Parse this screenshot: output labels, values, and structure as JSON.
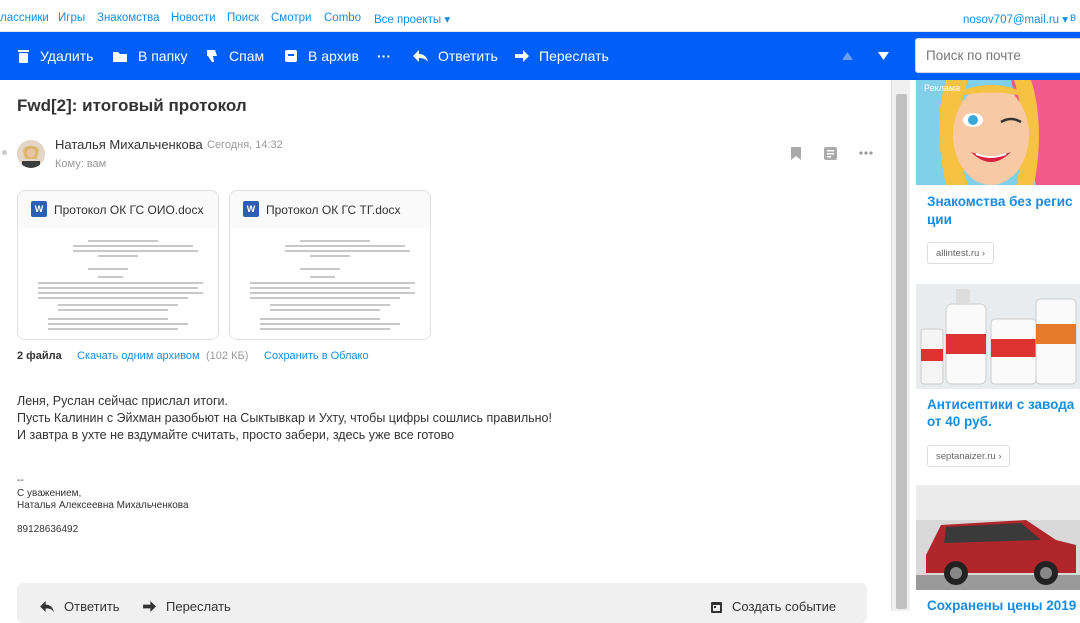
{
  "topnav": {
    "items": [
      "лассники",
      "Игры",
      "Знакомства",
      "Новости",
      "Поиск",
      "Смотри",
      "Combo",
      "Все проекты ▾"
    ],
    "user": "nosov707@mail.ru ▾",
    "extra": "в"
  },
  "toolbar": {
    "delete": "Удалить",
    "to_folder": "В папку",
    "spam": "Спам",
    "archive": "В архив",
    "more": "···",
    "reply": "Ответить",
    "forward": "Переслать",
    "search_placeholder": "Поиск по почте"
  },
  "message": {
    "subject": "Fwd[2]: итоговый протокол",
    "sender": "Наталья Михальченкова",
    "date": "Сегодня, 14:32",
    "to": "Кому: вам",
    "attachments": [
      {
        "name": "Протокол ОК ГС ОИО.docx"
      },
      {
        "name": "Протокол ОК ГС ТГ.docx"
      }
    ],
    "files_count": "2 файла",
    "download_all": "Скачать одним архивом",
    "archive_size": "(102 КБ)",
    "save_cloud": "Сохранить в Облако",
    "body_lines": [
      "Леня, Руслан сейчас прислал итоги.",
      "Пусть Калинин с Эйхман разобьют на Сыктывкар и Ухту, чтобы цифры сошлись правильно!",
      "И завтра в ухте не вздумайте считать, просто забери, здесь уже все готово"
    ],
    "sig_dash": "--",
    "sig_regards": "С уважением,",
    "sig_name": "Наталья Алексеевна Михальченкова",
    "sig_phone": "89128636492"
  },
  "reply_bar": {
    "reply": "Ответить",
    "forward": "Переслать",
    "create_event": "Создать событие"
  },
  "ads": {
    "label": "Реклама",
    "items": [
      {
        "title_1": "Знакомства без регис",
        "title_2": "ции",
        "url": "allintest.ru ›"
      },
      {
        "title_1": "Антисептики с завода",
        "title_2": "от 40 руб.",
        "url": "septanaizer.ru ›"
      },
      {
        "title_1": "Сохранены цены 2019"
      }
    ]
  },
  "colors": {
    "toolbar_bg": "#005ff9",
    "link": "#168de2"
  }
}
